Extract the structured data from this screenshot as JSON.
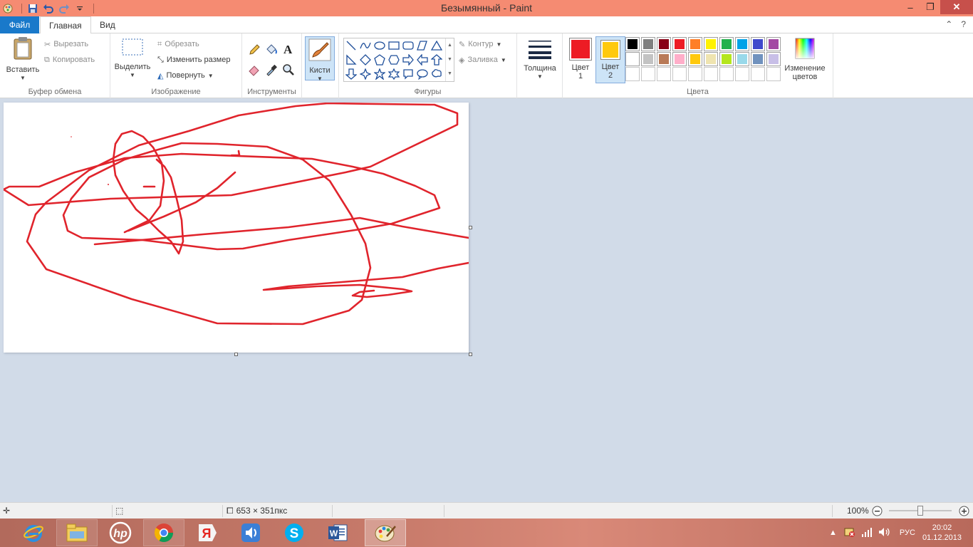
{
  "window": {
    "title": "Безымянный - Paint",
    "controls": {
      "minimize": "–",
      "maximize": "❐",
      "close": "✕"
    }
  },
  "quick_access": [
    "paint-menu-icon",
    "save-icon",
    "undo-icon",
    "redo-icon",
    "customize-icon"
  ],
  "tabs": {
    "file": "Файл",
    "home": "Главная",
    "view": "Вид",
    "active": "Главная"
  },
  "ribbon": {
    "clipboard": {
      "label": "Буфер обмена",
      "paste": "Вставить",
      "cut": "Вырезать",
      "copy": "Копировать"
    },
    "image": {
      "label": "Изображение",
      "select": "Выделить",
      "crop": "Обрезать",
      "resize": "Изменить размер",
      "rotate": "Повернуть"
    },
    "tools": {
      "label": "Инструменты"
    },
    "brushes": {
      "label": "Кисти"
    },
    "shapes": {
      "label": "Фигуры",
      "outline": "Контур",
      "fill": "Заливка"
    },
    "size": {
      "label": "Толщина"
    },
    "colors": {
      "label": "Цвета",
      "color1_line1": "Цвет",
      "color1_line2": "1",
      "color1_value": "#ed1c24",
      "color2_line1": "Цвет",
      "color2_line2": "2",
      "color2_value": "#ffc90e",
      "edit_line1": "Изменение",
      "edit_line2": "цветов",
      "palette_row1": [
        "#000000",
        "#7f7f7f",
        "#880015",
        "#ed1c24",
        "#ff7f27",
        "#fff200",
        "#22b14c",
        "#00a2e8",
        "#3f48cc",
        "#a349a4"
      ],
      "palette_row2": [
        "#ffffff",
        "#c3c3c3",
        "#b97a57",
        "#ffaec9",
        "#ffc90e",
        "#efe4b0",
        "#b5e61d",
        "#99d9ea",
        "#7092be",
        "#c8bfe7"
      ],
      "palette_row3": [
        "",
        "",
        "",
        "",
        "",
        "",
        "",
        "",
        "",
        ""
      ]
    }
  },
  "canvas": {
    "background": "#ffffff",
    "stroke_color": "#e0242c"
  },
  "statusbar": {
    "image_size": "653 × 351пкс",
    "zoom": "100%",
    "zoom_level": 1.0
  },
  "taskbar": {
    "apps": [
      "internet-explorer-icon",
      "file-explorer-icon",
      "hp-icon",
      "chrome-icon",
      "yandex-icon",
      "volume-app-icon",
      "skype-icon",
      "word-icon",
      "paint-icon"
    ],
    "language": "РУС",
    "time": "20:02",
    "date": "01.12.2013"
  }
}
